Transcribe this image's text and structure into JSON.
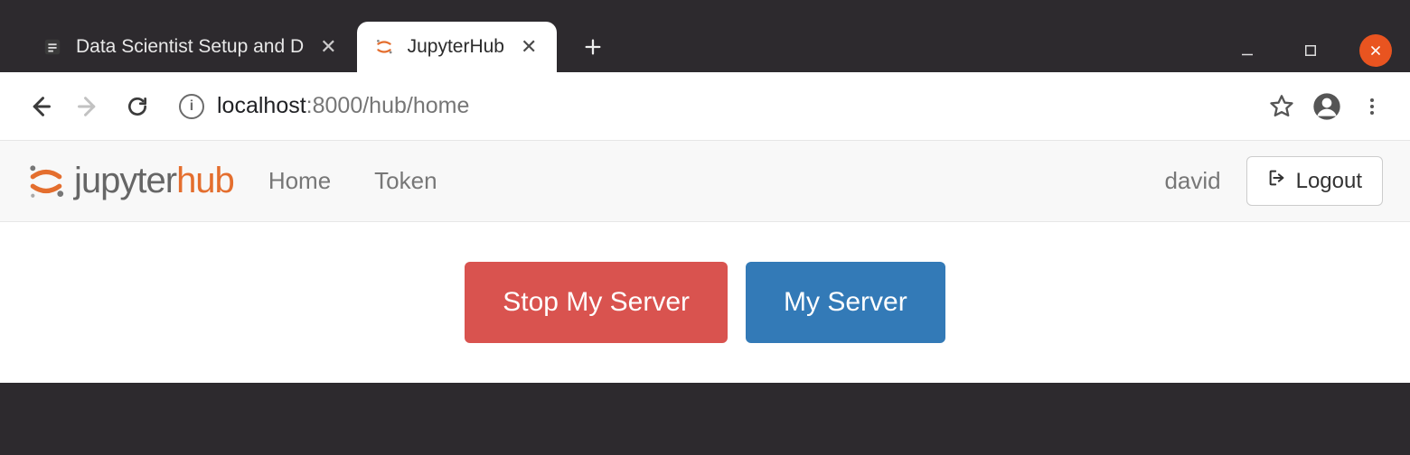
{
  "window": {
    "tabs": [
      {
        "title": "Data Scientist Setup and D",
        "active": false
      },
      {
        "title": "JupyterHub",
        "active": true
      }
    ]
  },
  "addressbar": {
    "host": "localhost",
    "rest": ":8000/hub/home"
  },
  "navbar": {
    "logo_jupyter": "jupyter",
    "logo_hub": "hub",
    "links": {
      "home": "Home",
      "token": "Token"
    },
    "username": "david",
    "logout_label": "Logout"
  },
  "main": {
    "stop_server_label": "Stop My Server",
    "my_server_label": "My Server"
  }
}
